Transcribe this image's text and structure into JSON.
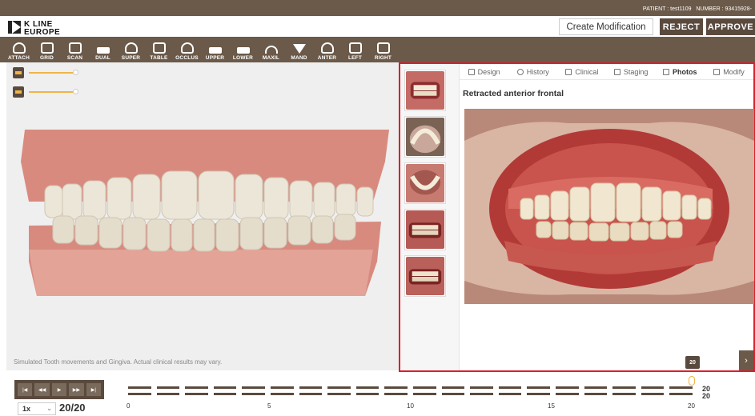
{
  "topbar": {
    "patient_label": "PATIENT : test1109",
    "number_label": "NUMBER : 93415928-"
  },
  "logo": {
    "line1": "K LINE",
    "line2": "EUROPE"
  },
  "header": {
    "create_label": "Create Modification",
    "reject_label": "REJECT",
    "approve_label": "APPROVE"
  },
  "toolbar": {
    "items": [
      "ATTACH",
      "GRID",
      "SCAN",
      "DUAL",
      "SUPER",
      "TABLE",
      "OCCLUS",
      "UPPER",
      "LOWER",
      "MAXIL",
      "MAND",
      "ANTER",
      "LEFT",
      "RIGHT"
    ]
  },
  "viewer": {
    "disclaimer": "Simulated Tooth movements and Gingiva. Actual clinical results may vary."
  },
  "tabs": [
    "Design",
    "History",
    "Clinical",
    "Staging",
    "Photos",
    "Modify"
  ],
  "active_tab": "Photos",
  "photo_title": "Retracted anterior frontal",
  "badge": "20",
  "playback": {
    "speed": "1x",
    "counter": "20/20",
    "buttons": [
      "|◀",
      "◀◀",
      "▶",
      "▶▶",
      "▶|"
    ]
  },
  "timeline": {
    "ticks": [
      "0",
      "5",
      "10",
      "15",
      "20"
    ],
    "upper_end": "20",
    "lower_end": "20",
    "current_step": 20,
    "total_steps": 20
  },
  "colors": {
    "brand_brown": "#6b5a4a",
    "accent_yellow": "#f0b545",
    "highlight_red": "#d9202b"
  }
}
